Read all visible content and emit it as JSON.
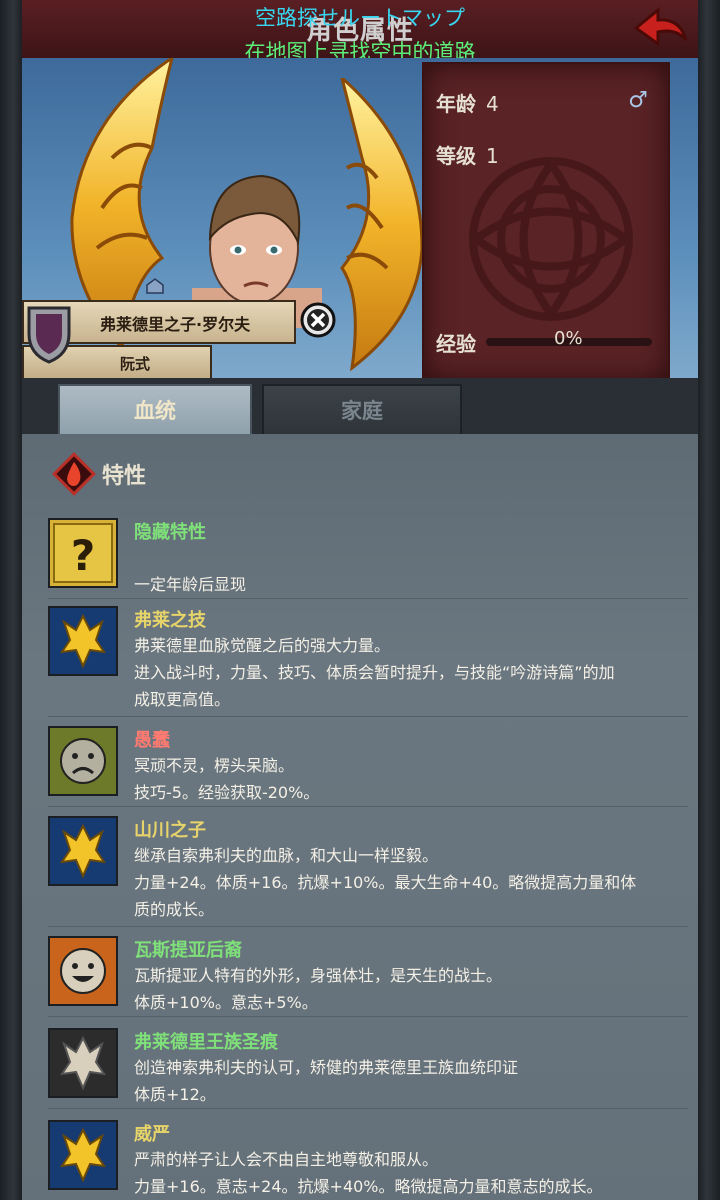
{
  "header": {
    "title": "角色属性",
    "overlay_jp": "空路探せルートマップ",
    "overlay_cn": "在地图上寻找空中的道路"
  },
  "character": {
    "name": "弗莱德里之子·罗尔夫",
    "surname": "阮式",
    "age_label": "年龄",
    "age": "4",
    "level_label": "等级",
    "level": "1",
    "exp_label": "经验",
    "exp_pct": "0%",
    "exp_fraction": 0,
    "gender_symbol": "♂"
  },
  "tabs": [
    {
      "label": "血统",
      "active": true
    },
    {
      "label": "家庭",
      "active": false
    }
  ],
  "section": {
    "title": "特性",
    "icon": "fire-icon"
  },
  "traits": [
    {
      "name": "隐藏特性",
      "color": "green",
      "icon": "question-icon",
      "lines": [
        "",
        "一定年龄后显现"
      ]
    },
    {
      "name": "弗莱之技",
      "color": "yellow",
      "icon": "golden-crest-icon",
      "lines": [
        "弗莱德里血脉觉醒之后的强大力量。",
        "进入战斗时，力量、技巧、体质会暂时提升，与技能“吟游诗篇”的加",
        "成取更高值。"
      ]
    },
    {
      "name": "愚蠢",
      "color": "red",
      "icon": "sad-face-icon",
      "lines": [
        "冥顽不灵，楞头呆脑。",
        "技巧-5。经验获取-20%。"
      ]
    },
    {
      "name": "山川之子",
      "color": "yellow",
      "icon": "golden-crest-icon",
      "lines": [
        "继承自索弗利夫的血脉，和大山一样坚毅。",
        "力量+24。体质+16。抗爆+10%。最大生命+40。略微提高力量和体",
        "质的成长。"
      ]
    },
    {
      "name": "瓦斯提亚后裔",
      "color": "green",
      "icon": "smile-face-icon",
      "lines": [
        "瓦斯提亚人特有的外形，身强体壮，是天生的战士。",
        "体质+10%。意志+5%。"
      ]
    },
    {
      "name": "弗莱德里王族圣痕",
      "color": "green",
      "icon": "silver-crest-icon",
      "lines": [
        "创造神索弗利夫的认可，矫健的弗莱德里王族血统印证",
        "体质+12。"
      ]
    },
    {
      "name": "威严",
      "color": "yellow",
      "icon": "golden-crest-icon",
      "lines": [
        "严肃的样子让人会不由自主地尊敬和服从。",
        "力量+16。意志+24。抗爆+40%。略微提高力量和意志的成长。"
      ]
    }
  ]
}
